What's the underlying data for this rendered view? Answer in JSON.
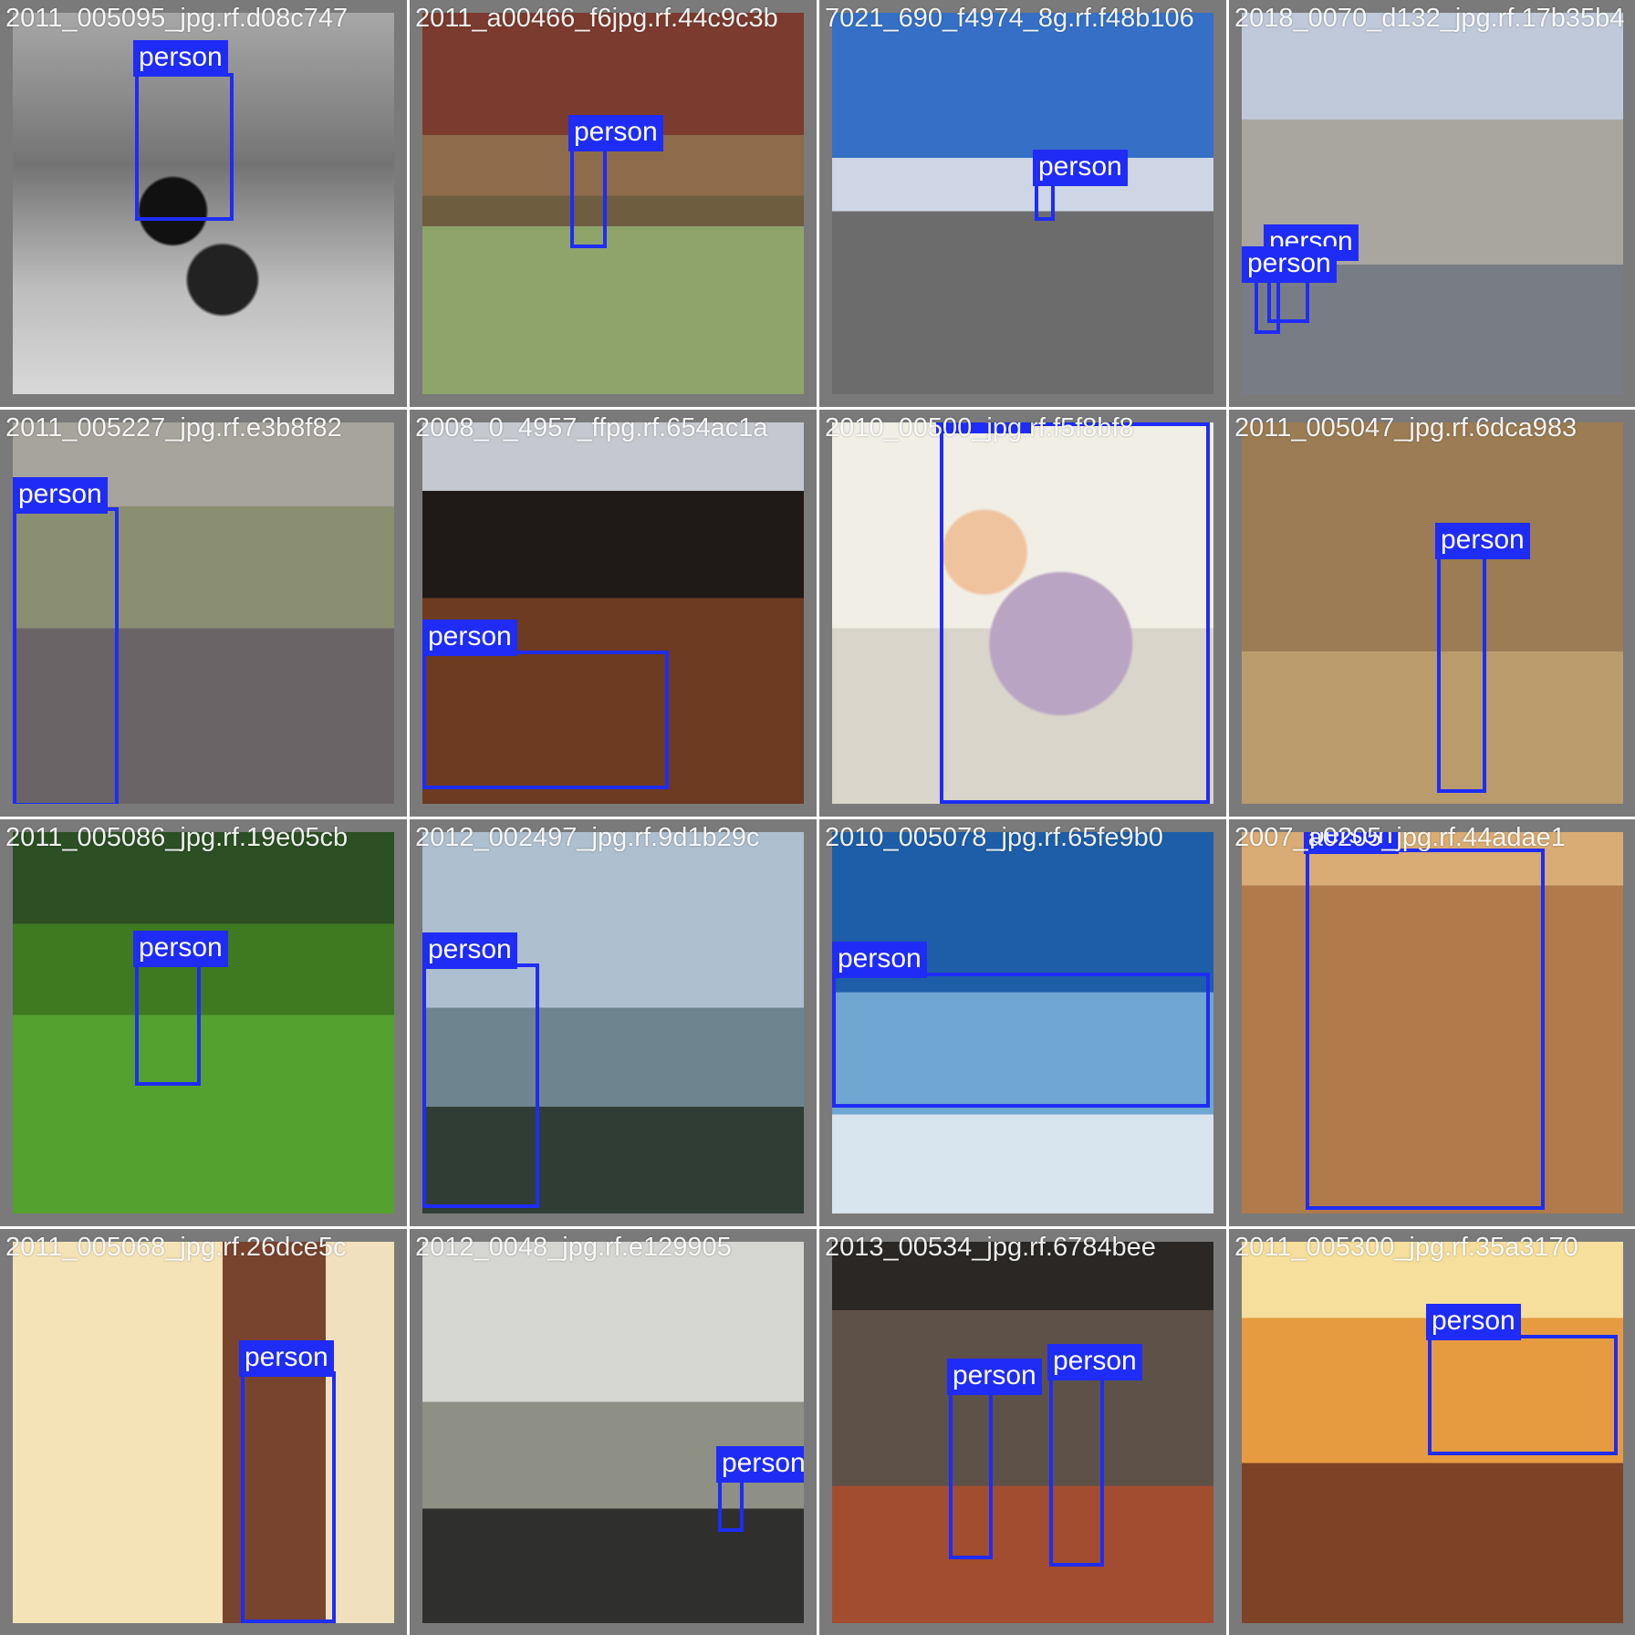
{
  "tiles": [
    {
      "filename": "2011_005095_jpg.rf.d08c747",
      "overlap_text": "2011_a00466_f6jpg.rf.44c9c3b",
      "bg": [
        "#111111",
        "#707070",
        "#c8c8c8"
      ],
      "labels": [
        "person"
      ]
    },
    {
      "filename": "2011_a00466_f6jpg.rf.44c9c3b",
      "bg": [
        "#7b3b2e",
        "#8d6b4b",
        "#8fa46b"
      ],
      "labels": [
        "person"
      ]
    },
    {
      "filename": "7021_690_f4974_8g.rf.f48b106",
      "bg": [
        "#3570c6",
        "#ced6e6",
        "#6d6c6c"
      ],
      "labels": [
        "person"
      ]
    },
    {
      "filename": "2018_0070_d132_jpg.rf.17b35b4",
      "bg": [
        "#a9a69f",
        "#787c85",
        "#d8cbb0"
      ],
      "labels": [
        "person",
        "person"
      ]
    },
    {
      "filename": "2011_005227_jpg.rf.e3b8f82",
      "bg": [
        "#8a8f72",
        "#b89c77",
        "#6a6467"
      ],
      "labels": [
        "person"
      ]
    },
    {
      "filename": "2008_0_4957_ffpg.rf.654ac1a",
      "bg": [
        "#1f1a17",
        "#6d3a22",
        "#c5c9cf"
      ],
      "labels": [
        "person"
      ]
    },
    {
      "filename": "2010_00500_jpg.rf.f5f8bf8",
      "bg": [
        "#f1efe5",
        "#d9d5ca",
        "#b9a4c4"
      ],
      "labels": [
        "person"
      ]
    },
    {
      "filename": "2011_005047_jpg.rf.6dca983",
      "bg": [
        "#9b7c54",
        "#b99b6c",
        "#5e4534"
      ],
      "labels": [
        "person"
      ]
    },
    {
      "filename": "2011_005086_jpg.rf.19e05cb",
      "bg": [
        "#2c4f24",
        "#55a12f",
        "#3f7a21"
      ],
      "labels": [
        "person"
      ]
    },
    {
      "filename": "2012_002497_jpg.rf.9d1b29c",
      "bg": [
        "#aebfcf",
        "#6e848f",
        "#2f3d35"
      ],
      "labels": [
        "person"
      ]
    },
    {
      "filename": "2010_005078_jpg.rf.65fe9b0",
      "bg": [
        "#1e5ea8",
        "#6fa6d2",
        "#d8e4ee"
      ],
      "labels": [
        "person"
      ]
    },
    {
      "filename": "2007_a0205_jpg.rf.44adae1",
      "bg": [
        "#b07a4a",
        "#c89563",
        "#6f4c35"
      ],
      "labels": [
        "person"
      ]
    },
    {
      "filename": "2011_005068_jpg.rf.26dce5c",
      "bg": [
        "#f5e3b8",
        "#78442d",
        "#26211f"
      ],
      "labels": [
        "person"
      ]
    },
    {
      "filename": "2012_0048_jpg.rf.e129905",
      "bg": [
        "#d5d5d1",
        "#8e8f85",
        "#2f302d"
      ],
      "labels": [
        "person"
      ]
    },
    {
      "filename": "2013_00534_jpg.rf.6784bee",
      "bg": [
        "#2a2724",
        "#5e5148",
        "#a24d2f"
      ],
      "labels": [
        "person",
        "person"
      ]
    },
    {
      "filename": "2011_005300_jpg.rf.35a3170",
      "bg": [
        "#f6df9c",
        "#e79b41",
        "#7d4326"
      ],
      "labels": [
        "person"
      ]
    }
  ],
  "colors": {
    "box": "#1f2cf5",
    "tile_border": "#7a7a7a",
    "label_text": "#ffffff"
  }
}
